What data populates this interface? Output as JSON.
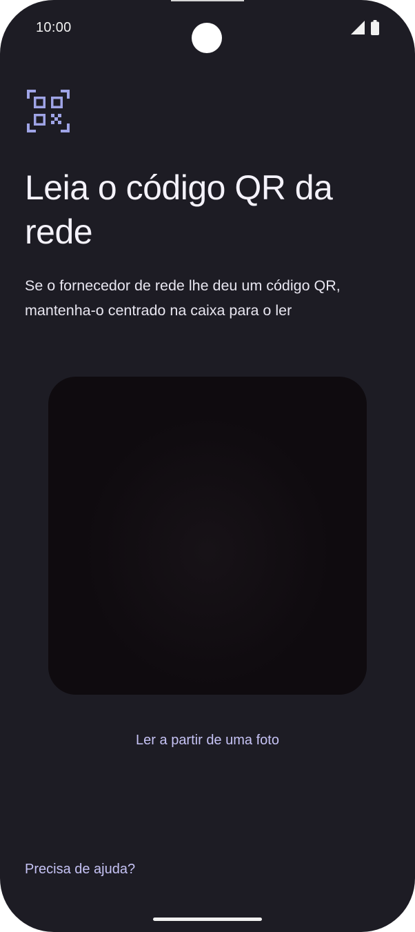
{
  "status_bar": {
    "time": "10:00",
    "icons": [
      "camera-cutout",
      "cellular-signal-icon",
      "battery-icon"
    ]
  },
  "page": {
    "header_icon": "qr-code-scan-icon",
    "title": "Leia o código QR da rede",
    "description": "Se o fornecedor de rede lhe deu um código QR, mantenha-o centrado na caixa para o ler"
  },
  "scanner": {
    "preview": "camera-viewfinder"
  },
  "actions": {
    "read_from_photo": "Ler a partir de uma foto",
    "need_help": "Precisa de ajuda?"
  },
  "colors": {
    "background": "#1d1c24",
    "accent": "#c6c3f5",
    "icon_accent": "#9fa4e6",
    "text_primary": "#f4f2fa",
    "viewfinder": "#0f0b0f"
  }
}
